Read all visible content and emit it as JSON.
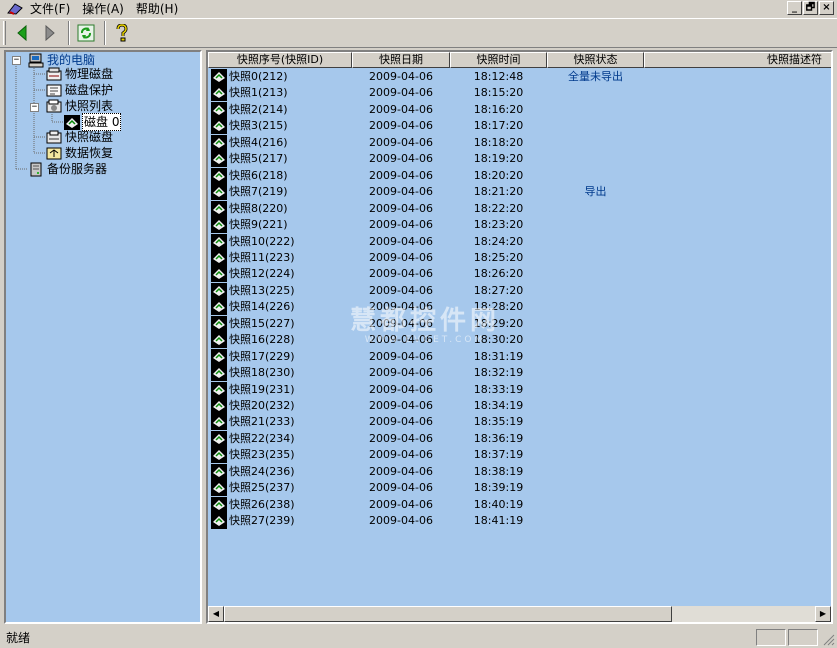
{
  "menu": {
    "items": [
      "文件(F)",
      "操作(A)",
      "帮助(H)"
    ],
    "window_buttons": [
      "_",
      "🗗",
      "×"
    ]
  },
  "toolbar": {
    "icons": [
      "back-arrow-icon",
      "forward-arrow-icon",
      "refresh-icon",
      "help-icon"
    ]
  },
  "tree": {
    "root": "我的电脑",
    "physical_disk": "物理磁盘",
    "disk_protect": "磁盘保护",
    "snapshot_list": "快照列表",
    "disk0": "磁盘 0",
    "snapshot_disk": "快照磁盘",
    "data_restore": "数据恢复",
    "backup_server": "备份服务器"
  },
  "list": {
    "columns": [
      "快照序号(快照ID)",
      "快照日期",
      "快照时间",
      "快照状态",
      "快照描述符"
    ],
    "rows": [
      {
        "name": "快照0(212)",
        "date": "2009-04-06",
        "time": "18:12:48",
        "status": "全量未导出"
      },
      {
        "name": "快照1(213)",
        "date": "2009-04-06",
        "time": "18:15:20",
        "status": ""
      },
      {
        "name": "快照2(214)",
        "date": "2009-04-06",
        "time": "18:16:20",
        "status": ""
      },
      {
        "name": "快照3(215)",
        "date": "2009-04-06",
        "time": "18:17:20",
        "status": ""
      },
      {
        "name": "快照4(216)",
        "date": "2009-04-06",
        "time": "18:18:20",
        "status": ""
      },
      {
        "name": "快照5(217)",
        "date": "2009-04-06",
        "time": "18:19:20",
        "status": ""
      },
      {
        "name": "快照6(218)",
        "date": "2009-04-06",
        "time": "18:20:20",
        "status": ""
      },
      {
        "name": "快照7(219)",
        "date": "2009-04-06",
        "time": "18:21:20",
        "status": "导出"
      },
      {
        "name": "快照8(220)",
        "date": "2009-04-06",
        "time": "18:22:20",
        "status": ""
      },
      {
        "name": "快照9(221)",
        "date": "2009-04-06",
        "time": "18:23:20",
        "status": ""
      },
      {
        "name": "快照10(222)",
        "date": "2009-04-06",
        "time": "18:24:20",
        "status": ""
      },
      {
        "name": "快照11(223)",
        "date": "2009-04-06",
        "time": "18:25:20",
        "status": ""
      },
      {
        "name": "快照12(224)",
        "date": "2009-04-06",
        "time": "18:26:20",
        "status": ""
      },
      {
        "name": "快照13(225)",
        "date": "2009-04-06",
        "time": "18:27:20",
        "status": ""
      },
      {
        "name": "快照14(226)",
        "date": "2009-04-06",
        "time": "18:28:20",
        "status": ""
      },
      {
        "name": "快照15(227)",
        "date": "2009-04-06",
        "time": "18:29:20",
        "status": ""
      },
      {
        "name": "快照16(228)",
        "date": "2009-04-06",
        "time": "18:30:20",
        "status": ""
      },
      {
        "name": "快照17(229)",
        "date": "2009-04-06",
        "time": "18:31:19",
        "status": ""
      },
      {
        "name": "快照18(230)",
        "date": "2009-04-06",
        "time": "18:32:19",
        "status": ""
      },
      {
        "name": "快照19(231)",
        "date": "2009-04-06",
        "time": "18:33:19",
        "status": ""
      },
      {
        "name": "快照20(232)",
        "date": "2009-04-06",
        "time": "18:34:19",
        "status": ""
      },
      {
        "name": "快照21(233)",
        "date": "2009-04-06",
        "time": "18:35:19",
        "status": ""
      },
      {
        "name": "快照22(234)",
        "date": "2009-04-06",
        "time": "18:36:19",
        "status": ""
      },
      {
        "name": "快照23(235)",
        "date": "2009-04-06",
        "time": "18:37:19",
        "status": ""
      },
      {
        "name": "快照24(236)",
        "date": "2009-04-06",
        "time": "18:38:19",
        "status": ""
      },
      {
        "name": "快照25(237)",
        "date": "2009-04-06",
        "time": "18:39:19",
        "status": ""
      },
      {
        "name": "快照26(238)",
        "date": "2009-04-06",
        "time": "18:40:19",
        "status": ""
      },
      {
        "name": "快照27(239)",
        "date": "2009-04-06",
        "time": "18:41:19",
        "status": ""
      }
    ]
  },
  "status": {
    "text": "就绪"
  },
  "watermark": {
    "main": "慧都控件网",
    "sub": "WWW.EVGET.COM"
  },
  "colors": {
    "pane_bg": "#a6c8ec",
    "status_text": "#003a8c"
  }
}
